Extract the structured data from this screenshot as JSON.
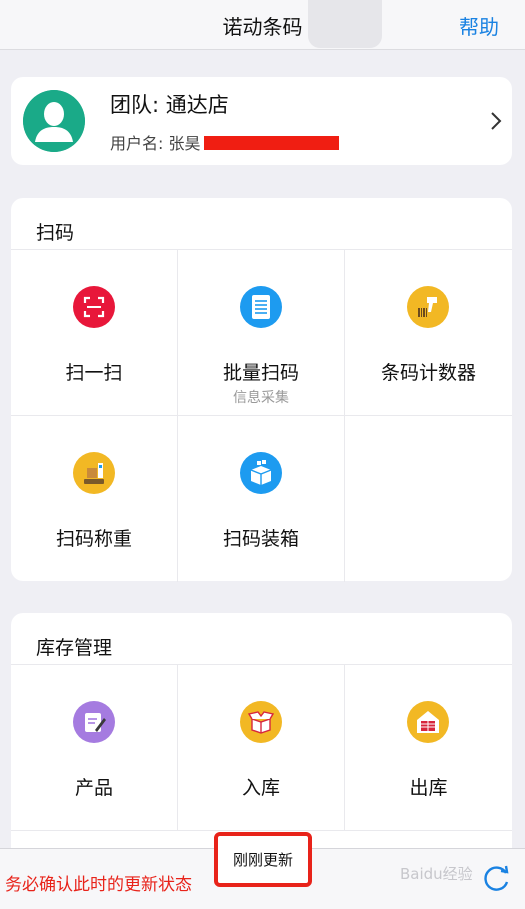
{
  "nav": {
    "title": "诺动条码",
    "help_label": "帮助"
  },
  "profile": {
    "team_label": "团队: 通达店",
    "user_label": "用户名: 张昊"
  },
  "scan_section": {
    "title": "扫码",
    "items": [
      {
        "label": "扫一扫",
        "sub": "",
        "icon": "scan-frame-icon",
        "color": "#e8173a"
      },
      {
        "label": "批量扫码",
        "sub": "信息采集",
        "icon": "document-list-icon",
        "color": "#1d9bf0"
      },
      {
        "label": "条码计数器",
        "sub": "",
        "icon": "barcode-scanner-icon",
        "color": "#f2b824"
      },
      {
        "label": "扫码称重",
        "sub": "",
        "icon": "weighing-scale-icon",
        "color": "#f2b824"
      },
      {
        "label": "扫码装箱",
        "sub": "",
        "icon": "packing-box-icon",
        "color": "#1d9bf0"
      }
    ]
  },
  "stock_section": {
    "title": "库存管理",
    "items": [
      {
        "label": "产品",
        "icon": "product-edit-icon",
        "color": "#a57be0"
      },
      {
        "label": "入库",
        "icon": "open-box-icon",
        "color": "#f2b824"
      },
      {
        "label": "出库",
        "icon": "warehouse-icon",
        "color": "#f2b824"
      }
    ]
  },
  "bottom": {
    "warning_text": "务必确认此时的更新状态",
    "update_status": "刚刚更新",
    "watermark": "Baidu经验"
  },
  "colors": {
    "accent": "#1a82e2",
    "warning": "#e8231a",
    "avatar": "#1aaa88"
  }
}
